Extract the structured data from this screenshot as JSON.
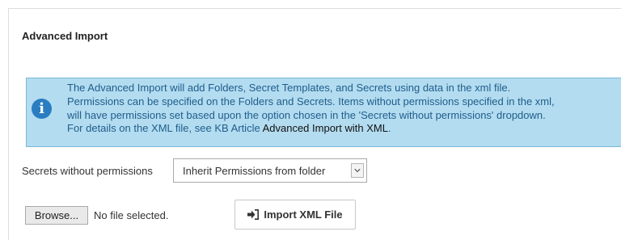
{
  "panel": {
    "title": "Advanced Import"
  },
  "info": {
    "icon": "info-icon",
    "icon_glyph": "i",
    "line1": "The Advanced Import will add Folders, Secret Templates, and Secrets using data in the xml file.",
    "line2": "Permissions can be specified on the Folders and Secrets. Items without permissions specified in the xml,",
    "line3": "will have permissions set based upon the option chosen in the 'Secrets without permissions' dropdown.",
    "line4_prefix": "For details on the XML file, see KB Article ",
    "link_text": "Advanced Import with XML",
    "line4_suffix": ".",
    "box_color": "#b3dcf0",
    "text_color": "#1f5d8c"
  },
  "permissions": {
    "label": "Secrets without permissions",
    "selected": "Inherit Permissions from folder",
    "arrow_icon": "chevron-down-icon"
  },
  "file": {
    "browse_label": "Browse...",
    "status": "No file selected."
  },
  "import_button": {
    "label": "Import XML File",
    "icon": "sign-in-icon"
  }
}
